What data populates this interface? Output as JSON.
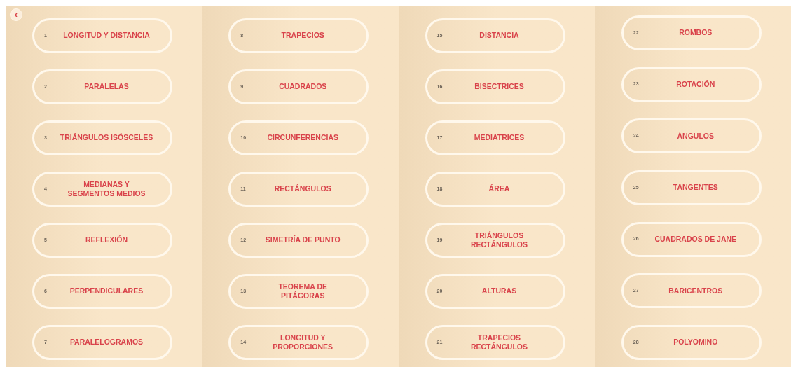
{
  "back_button": {
    "label": "‹"
  },
  "columns": [
    {
      "lessons": [
        {
          "number": "1",
          "title": "LONGITUD Y DISTANCIA"
        },
        {
          "number": "2",
          "title": "PARALELAS"
        },
        {
          "number": "3",
          "title": "TRIÁNGULOS ISÓSCELES"
        },
        {
          "number": "4",
          "title": "MEDIANAS Y SEGMENTOS MEDIOS"
        },
        {
          "number": "5",
          "title": "REFLEXIÓN"
        },
        {
          "number": "6",
          "title": "PERPENDICULARES"
        },
        {
          "number": "7",
          "title": "PARALELOGRAMOS"
        }
      ]
    },
    {
      "lessons": [
        {
          "number": "8",
          "title": "TRAPECIOS"
        },
        {
          "number": "9",
          "title": "CUADRADOS"
        },
        {
          "number": "10",
          "title": "CIRCUNFERENCIAS"
        },
        {
          "number": "11",
          "title": "RECTÁNGULOS"
        },
        {
          "number": "12",
          "title": "SIMETRÍA DE PUNTO"
        },
        {
          "number": "13",
          "title": "TEOREMA DE PITÁGORAS"
        },
        {
          "number": "14",
          "title": "LONGITUD Y PROPORCIONES"
        }
      ]
    },
    {
      "lessons": [
        {
          "number": "15",
          "title": "DISTANCIA"
        },
        {
          "number": "16",
          "title": "BISECTRICES"
        },
        {
          "number": "17",
          "title": "MEDIATRICES"
        },
        {
          "number": "18",
          "title": "ÁREA"
        },
        {
          "number": "19",
          "title": "TRIÁNGULOS RECTÁNGULOS"
        },
        {
          "number": "20",
          "title": "ALTURAS"
        },
        {
          "number": "21",
          "title": "TRAPECIOS RECTÁNGULOS"
        }
      ]
    },
    {
      "lessons": [
        {
          "number": "22",
          "title": "ROMBOS"
        },
        {
          "number": "23",
          "title": "ROTACIÓN"
        },
        {
          "number": "24",
          "title": "ÁNGULOS"
        },
        {
          "number": "25",
          "title": "TANGENTES"
        },
        {
          "number": "26",
          "title": "CUADRADOS DE JANE"
        },
        {
          "number": "27",
          "title": "BARICENTROS"
        },
        {
          "number": "28",
          "title": "POLYOMINO"
        }
      ]
    }
  ]
}
